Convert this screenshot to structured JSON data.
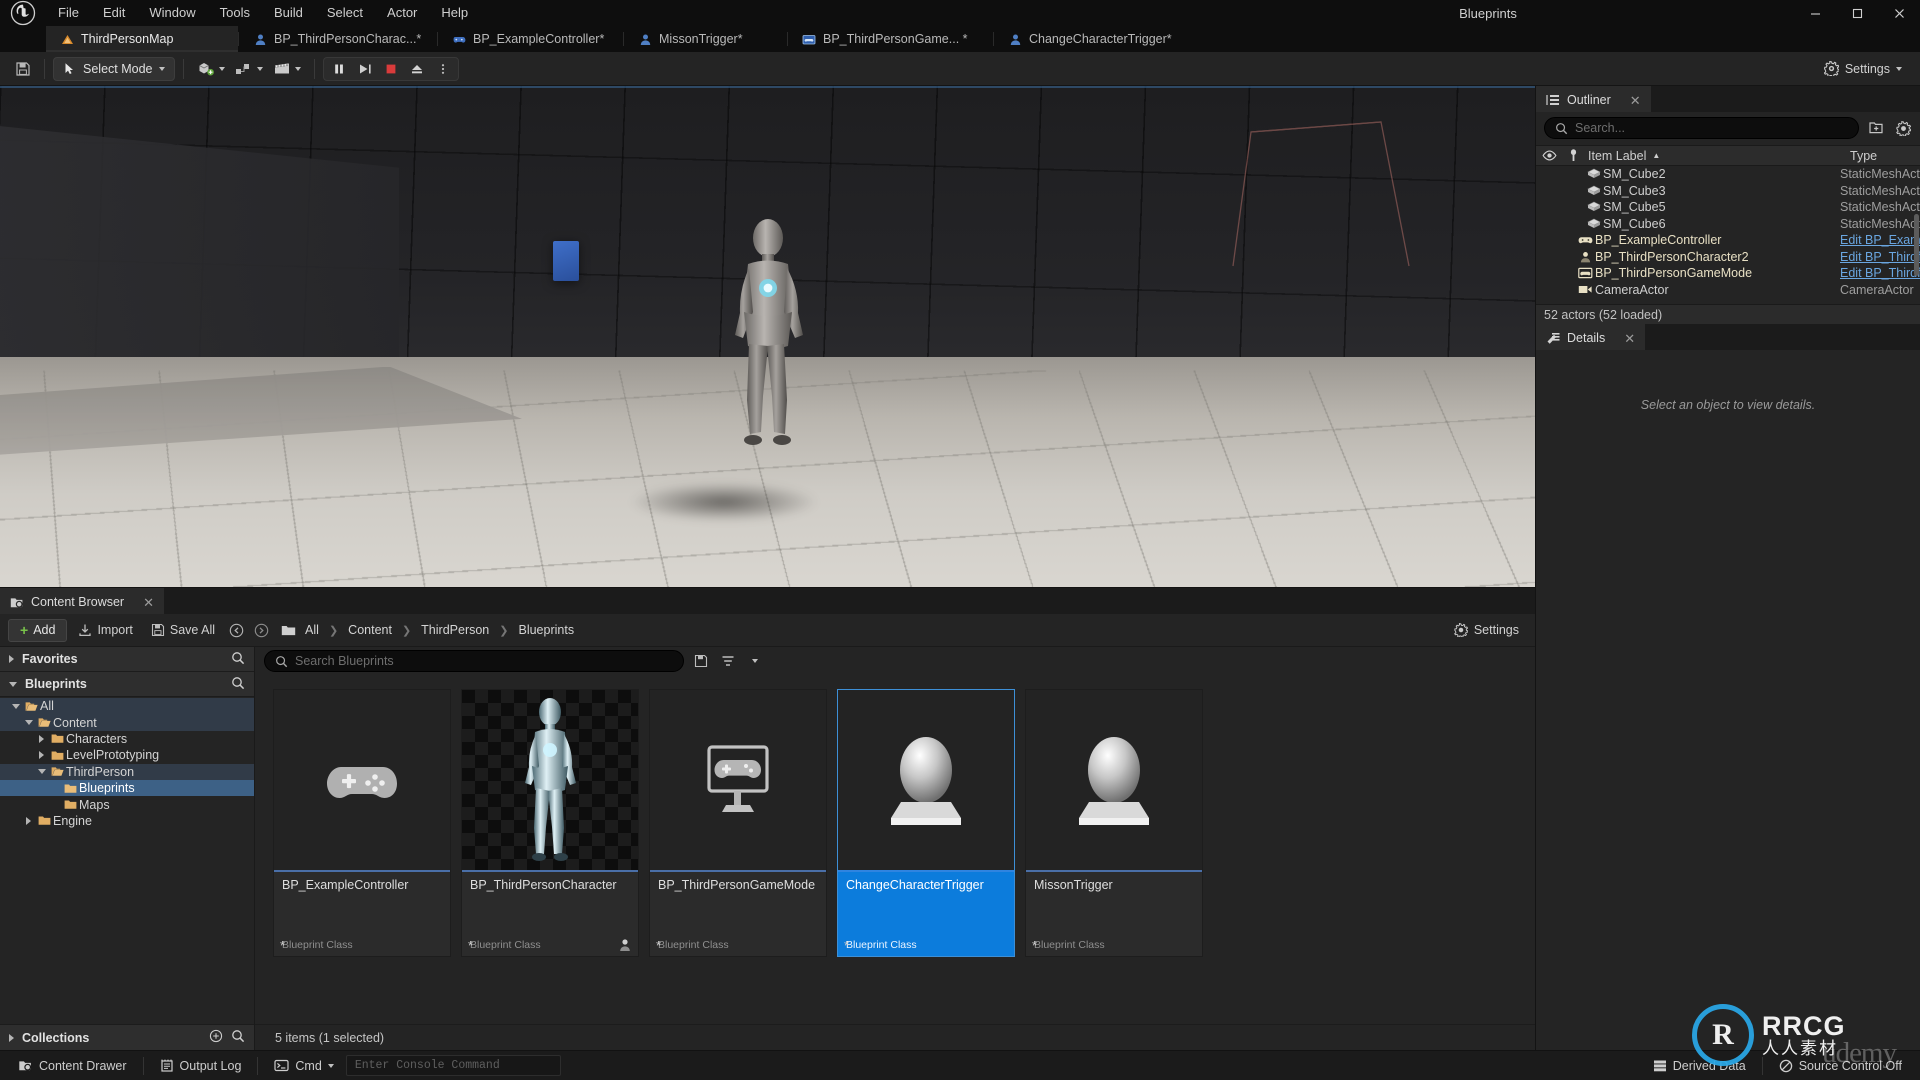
{
  "window": {
    "center_title": "Blueprints",
    "minimize": "–",
    "maximize": "□",
    "close": "✕"
  },
  "menu": {
    "items": [
      {
        "label": "File"
      },
      {
        "label": "Edit"
      },
      {
        "label": "Window"
      },
      {
        "label": "Tools"
      },
      {
        "label": "Build"
      },
      {
        "label": "Select"
      },
      {
        "label": "Actor"
      },
      {
        "label": "Help"
      }
    ]
  },
  "tabs": [
    {
      "label": "ThirdPersonMap",
      "icon": "map-icon",
      "active": true
    },
    {
      "label": "BP_ThirdPersonCharac...*",
      "icon": "character-icon",
      "active": false
    },
    {
      "label": "BP_ExampleController*",
      "icon": "gamepad-icon",
      "active": false
    },
    {
      "label": "MissonTrigger*",
      "icon": "character-icon",
      "active": false
    },
    {
      "label": "BP_ThirdPersonGame...  *",
      "icon": "gamemode-icon",
      "active": false
    },
    {
      "label": "ChangeCharacterTrigger*",
      "icon": "character-icon",
      "active": false
    }
  ],
  "toolbar": {
    "save_tooltip": "Save",
    "select_mode": "Select Mode",
    "add_tooltip": "Add",
    "transform_tooltip": "Transform",
    "settings_tooltip": "Level Settings",
    "pause_tooltip": "Pause",
    "play_tooltip": "Play",
    "stop_tooltip": "Stop",
    "eject_tooltip": "Eject",
    "more_tooltip": "More",
    "settings_label": "Settings"
  },
  "outliner": {
    "title": "Outliner",
    "close": "✕",
    "search_placeholder": "Search...",
    "search_value": "",
    "columns": {
      "item_label": "Item Label",
      "sort_arrow": "▲",
      "type": "Type"
    },
    "rows": [
      {
        "name": "SM_Cube2",
        "type": "StaticMeshAct",
        "icon": "mesh-icon",
        "kind": "mesh",
        "link": false
      },
      {
        "name": "SM_Cube3",
        "type": "StaticMeshAct",
        "icon": "mesh-icon",
        "kind": "mesh",
        "link": false
      },
      {
        "name": "SM_Cube5",
        "type": "StaticMeshAct",
        "icon": "mesh-icon",
        "kind": "mesh",
        "link": false
      },
      {
        "name": "SM_Cube6",
        "type": "StaticMeshAct",
        "icon": "mesh-icon",
        "kind": "mesh",
        "link": false
      },
      {
        "name": "BP_ExampleController",
        "type": "Edit BP_Examp",
        "icon": "gamepad-icon",
        "kind": "bp",
        "link": true
      },
      {
        "name": "BP_ThirdPersonCharacter2",
        "type": "Edit BP_Thirdf",
        "icon": "character-icon",
        "kind": "bp",
        "link": true
      },
      {
        "name": "BP_ThirdPersonGameMode",
        "type": "Edit BP_Thirdf",
        "icon": "gamemode-icon",
        "kind": "bp",
        "link": true
      },
      {
        "name": "CameraActor",
        "type": "CameraActor",
        "icon": "camera-icon",
        "kind": "mesh",
        "link": false
      }
    ],
    "status": "52 actors (52 loaded)"
  },
  "details": {
    "title": "Details",
    "close": "✕",
    "empty_message": "Select an object to view details."
  },
  "content_browser": {
    "title": "Content Browser",
    "close": "✕",
    "add_label": "Add",
    "import_label": "Import",
    "save_all_label": "Save All",
    "back_tooltip": "Back",
    "forward_tooltip": "Forward",
    "breadcrumb": [
      "All",
      "Content",
      "ThirdPerson",
      "Blueprints"
    ],
    "settings_label": "Settings",
    "search_placeholder": "Search Blueprints",
    "search_value": "",
    "save_search_tooltip": "Save Search",
    "filters_tooltip": "Filters",
    "sections": {
      "favorites": "Favorites",
      "blueprints": "Blueprints",
      "collections": "Collections"
    },
    "tree": [
      {
        "label": "All",
        "depth": 0,
        "expanded": true,
        "open_folder": true,
        "state": "soft"
      },
      {
        "label": "Content",
        "depth": 1,
        "expanded": true,
        "open_folder": true,
        "state": "soft"
      },
      {
        "label": "Characters",
        "depth": 2,
        "expanded": false,
        "open_folder": false,
        "state": "none"
      },
      {
        "label": "LevelPrototyping",
        "depth": 2,
        "expanded": false,
        "open_folder": false,
        "state": "none"
      },
      {
        "label": "ThirdPerson",
        "depth": 2,
        "expanded": true,
        "open_folder": true,
        "state": "soft"
      },
      {
        "label": "Blueprints",
        "depth": 3,
        "expanded": null,
        "open_folder": false,
        "state": "selected"
      },
      {
        "label": "Maps",
        "depth": 3,
        "expanded": null,
        "open_folder": false,
        "state": "none"
      },
      {
        "label": "Engine",
        "depth": 1,
        "expanded": false,
        "open_folder": false,
        "state": "none"
      }
    ],
    "assets": [
      {
        "name": "BP_ExampleController",
        "class": "Blueprint Class",
        "thumb": "gamepad",
        "selected": false,
        "modified": "*",
        "badge": ""
      },
      {
        "name": "BP_ThirdPersonCharacter",
        "class": "Blueprint Class",
        "thumb": "mannequin",
        "selected": false,
        "modified": "*",
        "badge": "character-badge"
      },
      {
        "name": "BP_ThirdPersonGameMode",
        "class": "Blueprint Class",
        "thumb": "gamemode",
        "selected": false,
        "modified": "*",
        "badge": ""
      },
      {
        "name": "ChangeCharacterTrigger",
        "class": "Blueprint Class",
        "thumb": "sphere",
        "selected": true,
        "modified": "*",
        "badge": ""
      },
      {
        "name": "MissonTrigger",
        "class": "Blueprint Class",
        "thumb": "sphere",
        "selected": false,
        "modified": "*",
        "badge": ""
      }
    ],
    "status": "5 items (1 selected)"
  },
  "statusbar": {
    "content_drawer": "Content Drawer",
    "output_log": "Output Log",
    "cmd_label": "Cmd",
    "console_placeholder": "Enter Console Command",
    "console_value": "",
    "derived_data": "Derived Data",
    "source_control": "Source Control Off"
  },
  "watermark": {
    "brand": "RRCG",
    "subtitle": "人人素材",
    "badge": "R",
    "overlay": "udemy"
  },
  "colors": {
    "accent_blue": "#0c7cdc",
    "selection_border": "#3d8fd6",
    "tree_selected": "#3d6186",
    "add_plus_green": "#79c24a",
    "link_blue": "#6aa6e0",
    "panel_bg": "#242424",
    "chrome_bg": "#1b1b1b"
  }
}
